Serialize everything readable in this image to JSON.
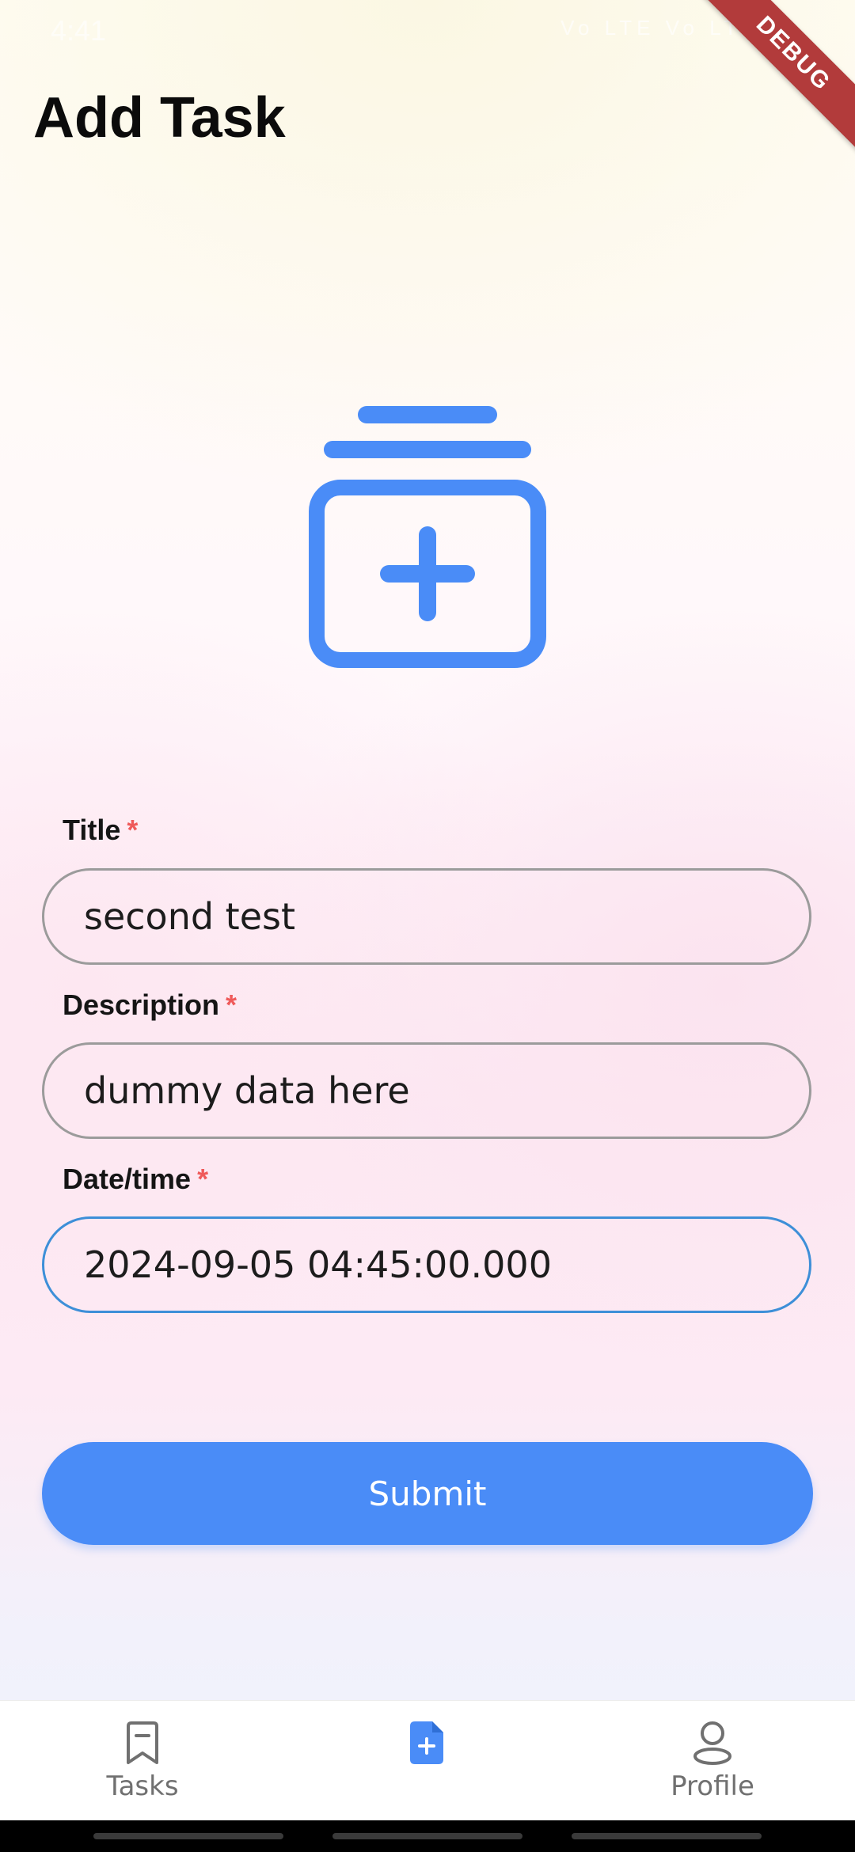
{
  "status_bar": {
    "time": "4:41",
    "icons": "Vo LTE  Vo LTE"
  },
  "debug_ribbon": "DEBUG",
  "page_title": "Add Task",
  "form": {
    "title": {
      "label": "Title",
      "required_mark": "*",
      "value": "second test"
    },
    "description": {
      "label": "Description",
      "required_mark": "*",
      "value": "dummy data here"
    },
    "datetime": {
      "label": "Date/time",
      "required_mark": "*",
      "value": "2024-09-05 04:45:00.000"
    },
    "submit_label": "Submit"
  },
  "bottom_nav": {
    "items": [
      {
        "label": "Tasks",
        "icon": "bookmark-icon",
        "active": false
      },
      {
        "label": "",
        "icon": "add-file-icon",
        "active": true
      },
      {
        "label": "Profile",
        "icon": "person-icon",
        "active": false
      }
    ]
  },
  "colors": {
    "accent": "#4a8cf7",
    "focus_border": "#3d8fd8",
    "required": "#ef5a5a",
    "debug": "#b23b3b"
  }
}
